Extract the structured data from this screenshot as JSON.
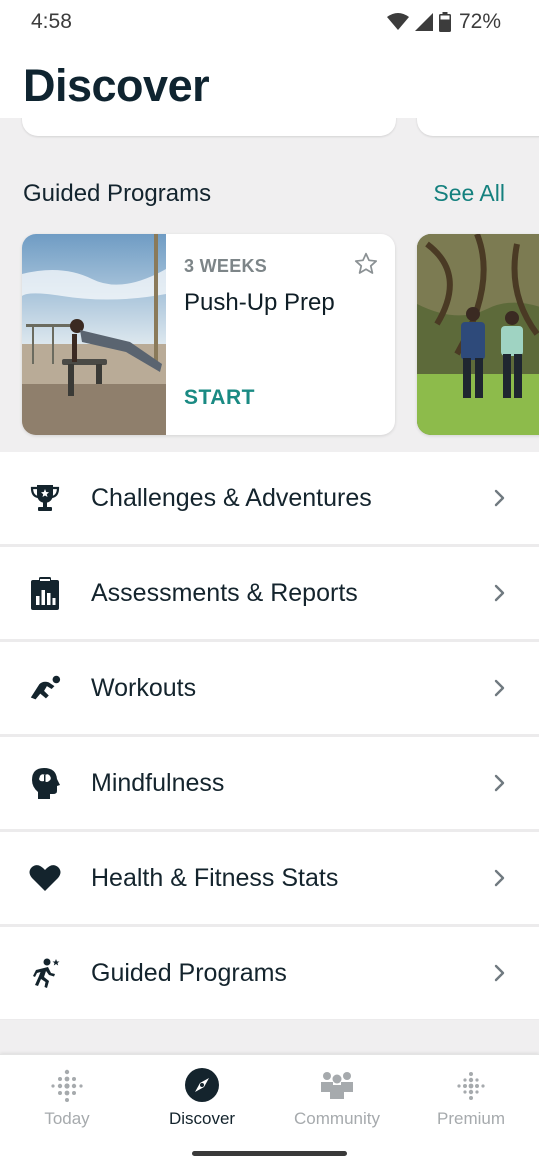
{
  "status_bar": {
    "time": "4:58",
    "battery": "72%",
    "icons": [
      "wifi-icon",
      "signal-icon",
      "battery-icon"
    ]
  },
  "header": {
    "title": "Discover"
  },
  "guided_programs": {
    "section_title": "Guided Programs",
    "see_all": "See All",
    "card": {
      "duration": "3 WEEKS",
      "name": "Push-Up Prep",
      "action": "START",
      "favorite_icon": "star-outline-icon"
    }
  },
  "menu": {
    "items": [
      {
        "label": "Challenges & Adventures",
        "icon": "trophy-icon"
      },
      {
        "label": "Assessments & Reports",
        "icon": "clipboard-chart-icon"
      },
      {
        "label": "Workouts",
        "icon": "workout-runner-icon"
      },
      {
        "label": "Mindfulness",
        "icon": "head-brain-icon"
      },
      {
        "label": "Health & Fitness Stats",
        "icon": "heart-icon"
      },
      {
        "label": "Guided Programs",
        "icon": "running-person-icon"
      }
    ]
  },
  "bottom_nav": {
    "items": [
      {
        "label": "Today",
        "icon": "dots-icon",
        "active": false
      },
      {
        "label": "Discover",
        "icon": "compass-icon",
        "active": true
      },
      {
        "label": "Community",
        "icon": "people-icon",
        "active": false
      },
      {
        "label": "Premium",
        "icon": "dots-premium-icon",
        "active": false
      }
    ]
  },
  "colors": {
    "accent": "#14807e",
    "text_dark": "#13242e",
    "background_grey": "#f0eff0",
    "inactive_nav": "#a6aaad"
  }
}
